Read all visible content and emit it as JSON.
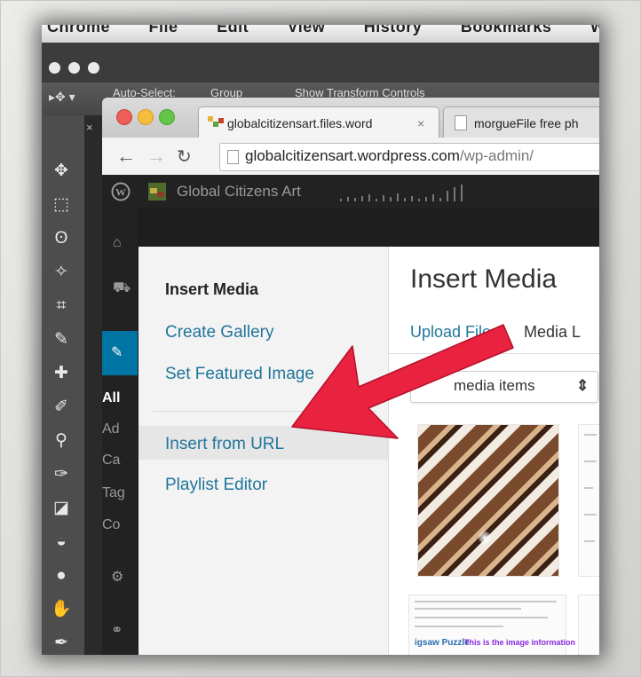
{
  "mac_menu": {
    "app": "Chrome",
    "items": [
      "File",
      "Edit",
      "View",
      "History",
      "Bookmarks",
      "Window"
    ]
  },
  "photoshop": {
    "options": {
      "auto_select_label": "Auto-Select:",
      "auto_select_value": "Group",
      "show_transform_label": "Show Transform Controls"
    },
    "panel_close": "×"
  },
  "browser": {
    "tabs": [
      {
        "title": "globalcitizensart.files.word",
        "close": "×"
      },
      {
        "title": "morgueFile free ph"
      }
    ],
    "url_host": "globalcitizensart.wordpress.com",
    "url_path": "/wp-admin/"
  },
  "wordpress": {
    "site_name": "Global Citizens Art",
    "sidebar_labels": [
      "All",
      "Ad",
      "Ca",
      "Tag",
      "Co"
    ]
  },
  "modal": {
    "menu": {
      "heading": "Insert Media",
      "links": [
        "Create Gallery",
        "Set Featured Image",
        "Insert from URL",
        "Playlist Editor"
      ]
    },
    "title": "Insert Media",
    "tabs": {
      "upload": "Upload Files",
      "library": "Media L"
    },
    "filter": {
      "value": "media items",
      "arrow": "⇕"
    },
    "thumb_text": {
      "title": "igsaw Puzzle",
      "note": "This is the image information b"
    }
  },
  "colors": {
    "link": "#21759b",
    "wp_active": "#0074a2",
    "arrow": "#e8223f"
  }
}
